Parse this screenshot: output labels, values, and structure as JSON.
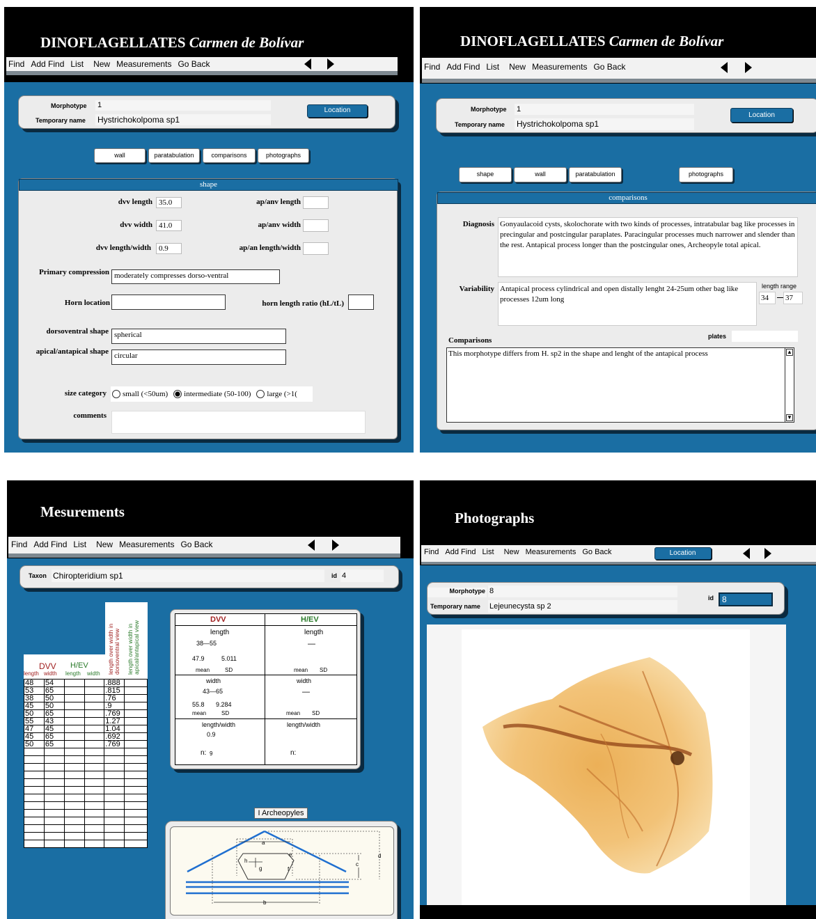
{
  "menu": {
    "items": [
      "Find",
      "Add Find",
      "List",
      "New",
      "Measurements",
      "Go Back"
    ]
  },
  "panel1": {
    "title_main": "DINOFLAGELLATES",
    "title_italic": "Carmen de Bolívar",
    "morphotype_label": "Morphotype",
    "morphotype_value": "1",
    "temp_name_label": "Temporary name",
    "temp_name_value": "Hystrichokolpoma sp1",
    "location_label": "Location",
    "tabs": [
      "wall",
      "paratabulation",
      "comparisons",
      "photographs"
    ],
    "section_title": "shape",
    "dvv_length_label": "dvv length",
    "dvv_length_value": "35.0",
    "dvv_width_label": "dvv width",
    "dvv_width_value": "41.0",
    "dvv_lw_label": "dvv length/width",
    "dvv_lw_value": "0.9",
    "ap_length_label": "ap/anv length",
    "ap_width_label": "ap/anv width",
    "ap_lw_label": "ap/an length/width",
    "primary_compression_label": "Primary compression",
    "primary_compression_value": "moderately compresses dorso-ventral",
    "horn_location_label": "Horn location",
    "horn_ratio_label": "horn length ratio (hL/tL)",
    "dorsoventral_shape_label": "dorsoventral shape",
    "dorsoventral_shape_value": "spherical",
    "apical_shape_label": "apical/antapical shape",
    "apical_shape_value": "circular",
    "size_category_label": "size category",
    "size_options": [
      "small (<50um)",
      "intermediate (50-100)",
      "large (>1("
    ],
    "size_selected": "intermediate (50-100)",
    "comments_label": "comments"
  },
  "panel2": {
    "title_main": "DINOFLAGELLATES",
    "title_italic": "Carmen de Bolívar",
    "morphotype_label": "Morphotype",
    "morphotype_value": "1",
    "temp_name_label": "Temporary name",
    "temp_name_value": "Hystrichokolpoma sp1",
    "location_label": "Location",
    "tabs": [
      "shape",
      "wall",
      "paratabulation",
      "photographs"
    ],
    "section_title": "comparisons",
    "diagnosis_label": "Diagnosis",
    "diagnosis_text": "Gonyaulacoid cysts, skolochorate with two kinds of processes, intratabular bag like processes in precingular and postcingular paraplates. Paracingular processes much narrower and slender than the rest. Antapical process longer than the postcingular ones, Archeopyle total apical.",
    "variability_label": "Variability",
    "variability_text": "Antapical process cylindrical and open distally lenght 24-25um other bag like processes 12um long",
    "length_range_label": "length range",
    "length_range_min": "34",
    "length_range_max": "37",
    "comparisons_label": "Comparisons",
    "plates_label": "plates",
    "comparisons_text": "This morphotype differs from H. sp2 in the shape and lenght of the antapical process"
  },
  "panel3": {
    "title": "Mesurements",
    "taxon_label": "Taxon",
    "taxon_value": "Chiropteridium sp1",
    "id_label": "id",
    "id_value": "4",
    "col_dvv": "DVV",
    "col_hev": "H/EV",
    "col_length": "length",
    "col_width": "width",
    "ratio_header_1": "length over width in dorsoventral view",
    "ratio_header_2": "length over width in apical/antapical view",
    "rows": [
      [
        "48",
        "54",
        "",
        "",
        ".888",
        ""
      ],
      [
        "53",
        "65",
        "",
        "",
        ".815",
        ""
      ],
      [
        "38",
        "50",
        "",
        "",
        ".76",
        ""
      ],
      [
        "45",
        "50",
        "",
        "",
        ".9",
        ""
      ],
      [
        "50",
        "65",
        "",
        "",
        ".769",
        ""
      ],
      [
        "55",
        "43",
        "",
        "",
        "1.27",
        ""
      ],
      [
        "47",
        "45",
        "",
        "",
        "1.04",
        ""
      ],
      [
        "45",
        "65",
        "",
        "",
        ".692",
        ""
      ],
      [
        "50",
        "65",
        "",
        "",
        ".769",
        ""
      ]
    ],
    "stats": {
      "dvv_header": "DVV",
      "hev_header": "H/EV",
      "length_label": "length",
      "width_label": "width",
      "lw_label": "length/width",
      "dvv_length_range": "38—55",
      "dvv_length_mean": "47.9",
      "dvv_length_sd": "5.011",
      "hev_length_range": "—",
      "dvv_width_range": "43—65",
      "dvv_width_mean": "55.8",
      "dvv_width_sd": "9.284",
      "hev_width_range": "—",
      "dvv_lw_value": "0.9",
      "mean_label": "mean",
      "sd_label": "SD",
      "n_label": "n:",
      "dvv_n": "9",
      "hev_n": ""
    },
    "archeopyles_tab": "I Archeopyles",
    "diagram_labels": [
      "a",
      "b",
      "c",
      "d",
      "e",
      "f",
      "g",
      "h"
    ]
  },
  "panel4": {
    "title": "Photographs",
    "location_label": "Location",
    "morphotype_label": "Morphotype",
    "morphotype_value": "8",
    "temp_name_label": "Temporary name",
    "temp_name_value": "Lejeunecysta sp 2",
    "id_label": "id",
    "id_value": "8"
  },
  "colors": {
    "panel_blue": "#1a6ea3",
    "header_black": "#000000",
    "dvv_red": "#a02020",
    "hev_green": "#2a7a2a"
  }
}
